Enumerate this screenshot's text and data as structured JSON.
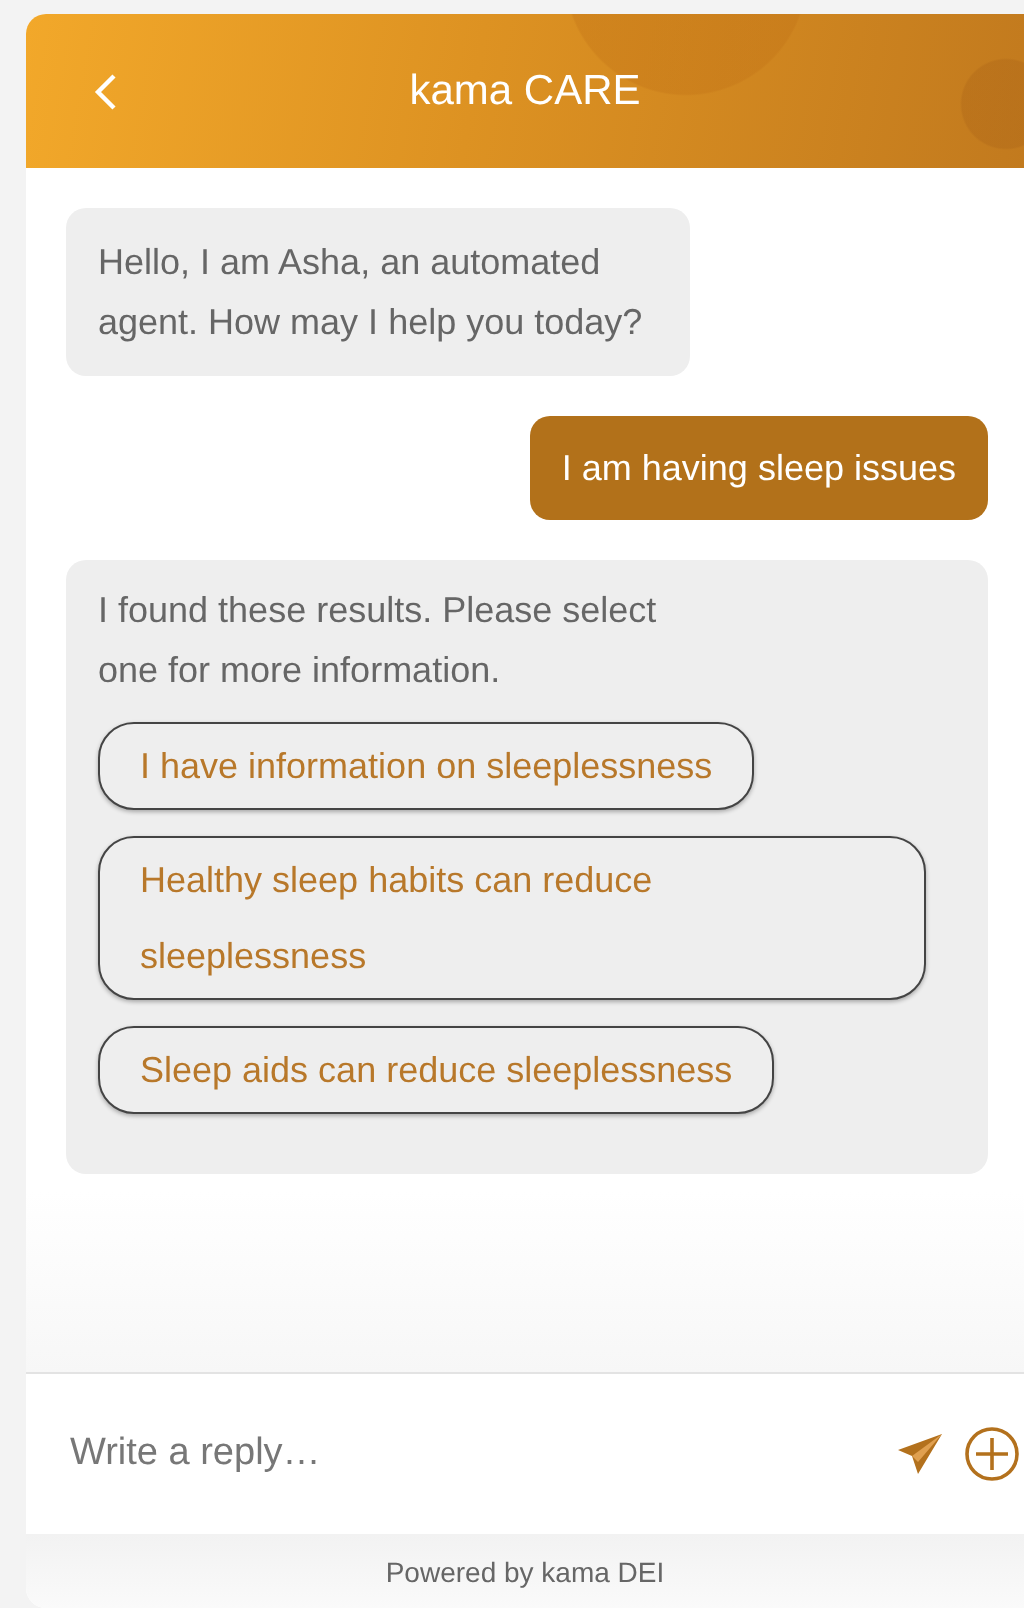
{
  "header": {
    "title": "kama CARE"
  },
  "messages": [
    {
      "kind": "bot",
      "text": "Hello, I am Asha, an automated agent. How may I help you today?"
    },
    {
      "kind": "user",
      "text": "I am having sleep issues"
    },
    {
      "kind": "bot",
      "text": "I found these results. Please select one for more information.",
      "options": [
        "I have information on sleeplessness",
        "Healthy sleep habits can reduce sleeplessness",
        "Sleep aids can reduce sleeplessness"
      ]
    }
  ],
  "composer": {
    "placeholder": "Write a reply…"
  },
  "footer": "Powered by kama DEI"
}
